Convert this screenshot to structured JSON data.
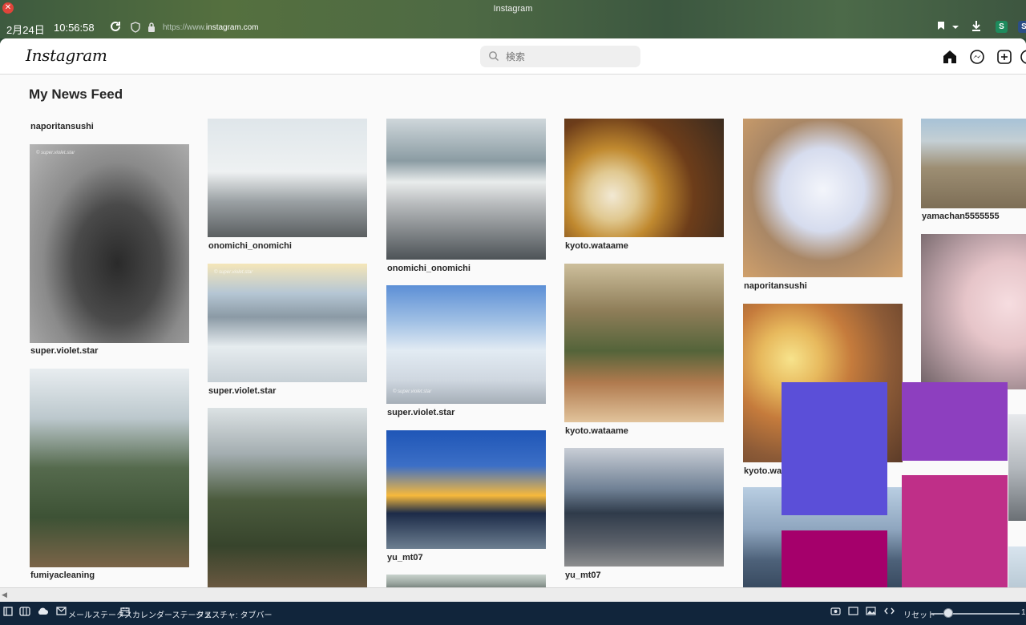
{
  "window": {
    "title": "Instagram",
    "close_glyph": "✕"
  },
  "toolbar": {
    "date": "2月24日",
    "time": "10:56:58",
    "url_prefix": "https://www.",
    "url_host": "instagram.com",
    "reload_icon": "reload-icon",
    "ext_s1": "S",
    "ext_s2": "S"
  },
  "header": {
    "logo": "Instagram",
    "search_placeholder": "検索"
  },
  "feed": {
    "title": "My News Feed",
    "first_user": "naporitansushi",
    "col1": [
      "super.violet.star",
      "fumiyacleaning"
    ],
    "col2": [
      "onomichi_onomichi",
      "super.violet.star"
    ],
    "col3": [
      "onomichi_onomichi",
      "super.violet.star",
      "yu_mt07"
    ],
    "col4": [
      "kyoto.wataame",
      "kyoto.wataame",
      "yu_mt07"
    ],
    "col5": [
      "naporitansushi",
      "kyoto.wa"
    ],
    "col6": [
      "yamachan5555555"
    ],
    "watermark": "© super.violet.star"
  },
  "statusbar": {
    "mail": "メールステータス",
    "calendar": "カレンダーステータス",
    "gesture": "ジェスチャ: タブバー",
    "reset": "リセット",
    "zoom_label": "1"
  },
  "colors": {
    "overlay_blue": "#5b4fd8",
    "overlay_purple": "#8d3fbf",
    "overlay_magenta": "#a5006b",
    "overlay_pink": "#bf2f88"
  }
}
